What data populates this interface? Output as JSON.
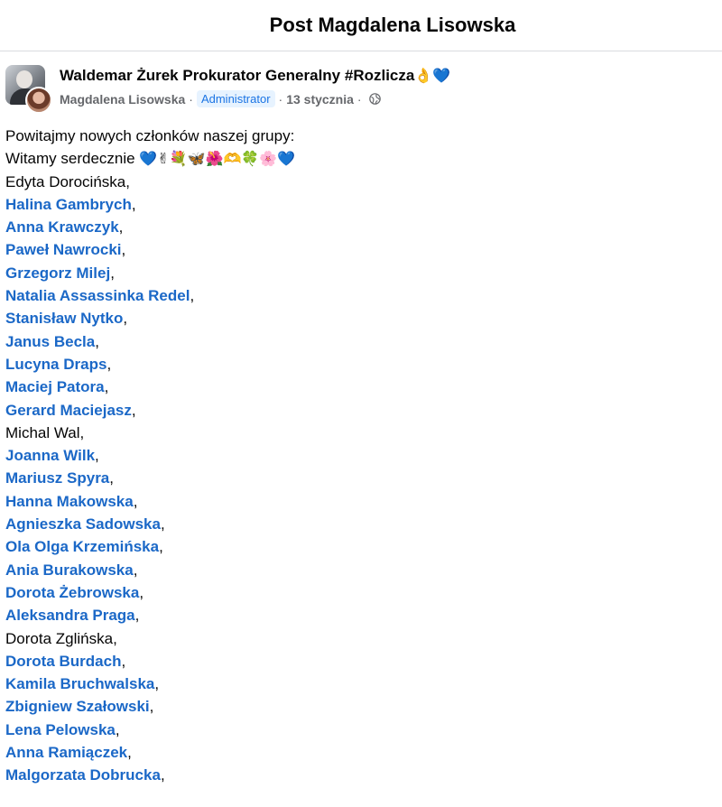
{
  "header": {
    "title": "Post Magdalena Lisowska"
  },
  "post": {
    "group_name": "Waldemar Żurek Prokurator Generalny #Rozlicza",
    "group_name_emoji": "👌💙",
    "author": "Magdalena Lisowska",
    "role_badge": "Administrator",
    "date": "13 stycznia",
    "separator": "·",
    "privacy_icon": "globe-icon",
    "intro_line": "Powitajmy nowych członków naszej grupy:",
    "greeting": "Witamy serdecznie",
    "greeting_emoji": "💙✌💐🦋🌺🫶🍀🌸💙",
    "members": [
      {
        "name": "Edyta Dorocińska",
        "linked": false
      },
      {
        "name": "Halina Gambrych",
        "linked": true
      },
      {
        "name": "Anna Krawczyk",
        "linked": true
      },
      {
        "name": "Paweł Nawrocki",
        "linked": true
      },
      {
        "name": "Grzegorz Milej",
        "linked": true
      },
      {
        "name": "Natalia Assassinka Redel",
        "linked": true
      },
      {
        "name": "Stanisław Nytko",
        "linked": true
      },
      {
        "name": "Janus Becla",
        "linked": true
      },
      {
        "name": "Lucyna Draps",
        "linked": true
      },
      {
        "name": "Maciej Patora",
        "linked": true
      },
      {
        "name": "Gerard Maciejasz",
        "linked": true
      },
      {
        "name": "Michal Wal",
        "linked": false
      },
      {
        "name": "Joanna Wilk",
        "linked": true
      },
      {
        "name": "Mariusz Spyra",
        "linked": true
      },
      {
        "name": "Hanna Makowska",
        "linked": true
      },
      {
        "name": "Agnieszka Sadowska",
        "linked": true
      },
      {
        "name": "Ola Olga Krzemińska",
        "linked": true
      },
      {
        "name": "Ania Burakowska",
        "linked": true
      },
      {
        "name": "Dorota Żebrowska",
        "linked": true
      },
      {
        "name": "Aleksandra Praga",
        "linked": true
      },
      {
        "name": "Dorota Zglińska",
        "linked": false
      },
      {
        "name": "Dorota Burdach",
        "linked": true
      },
      {
        "name": "Kamila Bruchwalska",
        "linked": true
      },
      {
        "name": "Zbigniew Szałowski",
        "linked": true
      },
      {
        "name": "Lena Pelowska",
        "linked": true
      },
      {
        "name": "Anna Ramiączek",
        "linked": true
      },
      {
        "name": "Malgorzata Dobrucka",
        "linked": true
      }
    ],
    "member_suffix": ","
  },
  "colors": {
    "link": "#1b68c7",
    "text": "#050505",
    "meta": "#65676b",
    "badge_bg": "#e7f3ff",
    "badge_text": "#1b74e4"
  }
}
